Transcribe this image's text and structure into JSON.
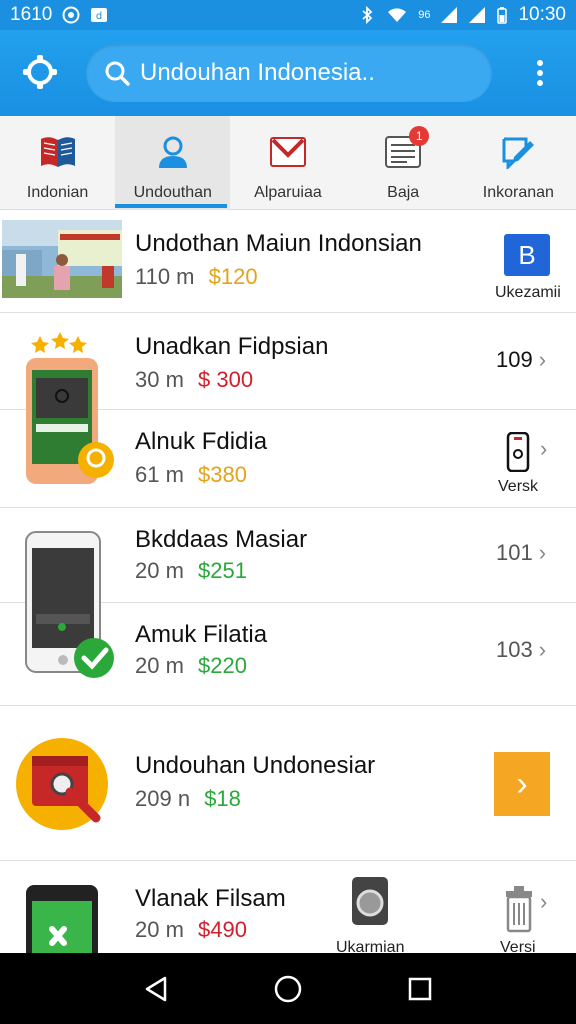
{
  "status_bar": {
    "left_number": "1610",
    "signal_label": "96",
    "time": "10:30"
  },
  "search": {
    "placeholder": "Undouhan Indonesia.."
  },
  "tabs": [
    {
      "label": "Indonian",
      "icon": "book-icon"
    },
    {
      "label": "Undouthan",
      "icon": "person-icon"
    },
    {
      "label": "Alparuiaa",
      "icon": "mail-icon"
    },
    {
      "label": "Baja",
      "icon": "news-icon",
      "badge": "1"
    },
    {
      "label": "Inkoranan",
      "icon": "edit-icon"
    }
  ],
  "items": [
    {
      "title": "Undothan Maiun Indonsian",
      "size": "110 m",
      "price": "$120",
      "trail_label": "Ukezamii",
      "trail_icon": "blue-b-icon"
    },
    {
      "title": "Unadkan Fidpsian",
      "size": "30 m",
      "price": "$ 300",
      "trail_value": "109"
    },
    {
      "title": "Alnuk Fdidia",
      "size": "61 m",
      "price": "$380",
      "trail_label": "Versk",
      "trail_icon": "phone-icon"
    },
    {
      "title": "Bkddaas Masiar",
      "size": "20 m",
      "price": "$251",
      "trail_value": "101"
    },
    {
      "title": "Amuk Filatia",
      "size": "20 m",
      "price": "$220",
      "trail_value": "103"
    },
    {
      "title": "Undouhan Undonesiar",
      "size": "209 n",
      "price": "$18"
    },
    {
      "title": "Vlanak Filsam",
      "size": "20 m",
      "price": "$490",
      "mid_label": "Ukarmian",
      "trail_label": "Versi"
    }
  ],
  "colors": {
    "accent": "#1b8fe0",
    "price_gold": "#e3a31a",
    "price_red": "#d21f2b",
    "price_green": "#2aa83a"
  }
}
